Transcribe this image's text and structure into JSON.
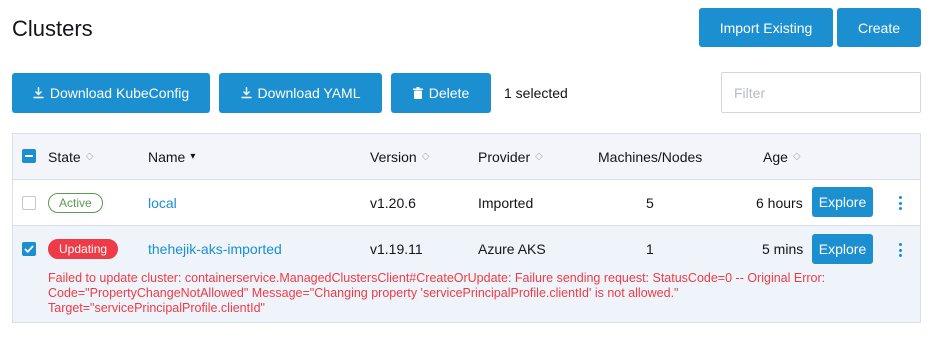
{
  "header": {
    "title": "Clusters",
    "import_label": "Import Existing",
    "create_label": "Create"
  },
  "toolbar": {
    "download_kubeconfig_label": "Download KubeConfig",
    "download_yaml_label": "Download YAML",
    "delete_label": "Delete",
    "selected_text": "1 selected",
    "filter_placeholder": "Filter"
  },
  "table": {
    "columns": {
      "state": "State",
      "name": "Name",
      "version": "Version",
      "provider": "Provider",
      "machines": "Machines/Nodes",
      "age": "Age"
    },
    "rows": [
      {
        "state": "Active",
        "name": "local",
        "version": "v1.20.6",
        "provider": "Imported",
        "machines": "5",
        "age": "6 hours",
        "action": "Explore",
        "selected": false
      },
      {
        "state": "Updating",
        "name": "thehejik-aks-imported",
        "version": "v1.19.11",
        "provider": "Azure AKS",
        "machines": "1",
        "age": "5 mins",
        "action": "Explore",
        "selected": true,
        "error": "Failed to update cluster: containerservice.ManagedClustersClient#CreateOrUpdate: Failure sending request: StatusCode=0 -- Original Error: Code=\"PropertyChangeNotAllowed\" Message=\"Changing property 'servicePrincipalProfile.clientId' is not allowed.\" Target=\"servicePrincipalProfile.clientId\""
      }
    ]
  },
  "colors": {
    "primary": "#1b8fd0",
    "error": "#ee3b47",
    "success": "#5c9a52",
    "header_bg": "#f4f5fa",
    "selected_row_bg": "#eef4fa"
  }
}
